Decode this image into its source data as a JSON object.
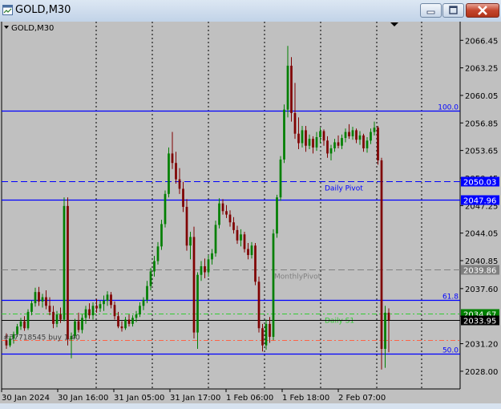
{
  "window": {
    "title": "GOLD,M30",
    "icon": "chart-window-icon",
    "controls": [
      "minimize-icon",
      "maximize-icon",
      "close-icon"
    ]
  },
  "chart_header": {
    "label": "GOLD,M30",
    "icon": "triangle-down-icon"
  },
  "colors": {
    "background": "#c0c0c0",
    "candle_up": "#007f00",
    "candle_down": "#7f0000",
    "level_line": "#0000ff",
    "monthly_pivot": "#808080",
    "daily_s1": "#32cd32",
    "order_line": "#ff6347",
    "price_tag_bg": "#0000ff",
    "current_price_bg": "#008000"
  },
  "chart_data": {
    "type": "candlestick",
    "symbol": "GOLD",
    "timeframe": "M30",
    "ylim": [
      2026.5,
      2067.5
    ],
    "y_ticks": [
      "2066.45",
      "2063.25",
      "2060.05",
      "2056.85",
      "2053.65",
      "2050.45",
      "2047.25",
      "2044.05",
      "2040.85",
      "2037.60",
      "2034.40",
      "2031.20",
      "2028.00"
    ],
    "x_ticks": [
      "30 Jan 2024",
      "30 Jan 16:00",
      "31 Jan 05:00",
      "31 Jan 17:00",
      "1 Feb 06:00",
      "1 Feb 18:00",
      "2 Feb 07:00"
    ],
    "levels": [
      {
        "name": "100.0",
        "price": 2058.3,
        "color": "#0000ff",
        "style": "solid",
        "label_side": "right"
      },
      {
        "name": "Daily Pivot",
        "price": 2050.03,
        "color": "#0000ff",
        "style": "dashed",
        "label_side": "center",
        "tag": "2050.03"
      },
      {
        "name": "",
        "price": 2047.96,
        "color": "#0000ff",
        "style": "solid",
        "label_side": "none",
        "tag": "2047.96"
      },
      {
        "name": "MonthlyPivot",
        "price": 2039.86,
        "color": "#808080",
        "style": "dashed",
        "label_side": "center",
        "tag": "2039.86"
      },
      {
        "name": "61.8",
        "price": 2036.3,
        "color": "#0000ff",
        "style": "solid",
        "label_side": "right"
      },
      {
        "name": "Daily S1",
        "price": 2034.67,
        "color": "#32cd32",
        "style": "dashdot",
        "label_side": "center",
        "tag": "2034.67"
      },
      {
        "name": "",
        "price": 2033.95,
        "color": "#000000",
        "style": "solid",
        "label_side": "none",
        "tag": "2033.95"
      },
      {
        "name": "",
        "price": 2031.6,
        "color": "#ff6347",
        "style": "dashdot",
        "label_side": "none"
      },
      {
        "name": "50.0",
        "price": 2030.0,
        "color": "#0000ff",
        "style": "solid",
        "label_side": "right"
      }
    ],
    "order_label": "#37718545 buy 1.40",
    "period_separators": [
      "30 Jan 16:00",
      "31 Jan 05:00",
      "31 Jan 17:00",
      "1 Feb 06:00",
      "1 Feb 18:00",
      "2 Feb 07:00",
      "2 Feb 20:00"
    ],
    "candles": [
      [
        2031.6,
        2032.4,
        2030.6,
        2031.0
      ],
      [
        2031.0,
        2032.1,
        2030.8,
        2031.8
      ],
      [
        2031.8,
        2032.6,
        2031.2,
        2032.3
      ],
      [
        2032.3,
        2033.5,
        2032.0,
        2033.2
      ],
      [
        2033.2,
        2034.2,
        2032.8,
        2033.8
      ],
      [
        2033.8,
        2034.4,
        2032.7,
        2033.0
      ],
      [
        2033.0,
        2035.2,
        2032.8,
        2034.9
      ],
      [
        2034.9,
        2036.2,
        2034.5,
        2035.9
      ],
      [
        2035.9,
        2037.7,
        2035.5,
        2037.2
      ],
      [
        2037.2,
        2037.8,
        2035.6,
        2036.1
      ],
      [
        2036.1,
        2037.0,
        2035.4,
        2036.6
      ],
      [
        2036.6,
        2037.4,
        2035.2,
        2035.6
      ],
      [
        2035.6,
        2036.6,
        2034.5,
        2034.9
      ],
      [
        2034.9,
        2035.6,
        2033.0,
        2033.5
      ],
      [
        2033.5,
        2035.0,
        2033.1,
        2034.6
      ],
      [
        2034.6,
        2035.4,
        2033.6,
        2034.0
      ],
      [
        2034.0,
        2048.2,
        2033.8,
        2047.2
      ],
      [
        2047.2,
        2048.2,
        2031.0,
        2031.7
      ],
      [
        2031.7,
        2032.5,
        2029.5,
        2032.1
      ],
      [
        2032.1,
        2034.1,
        2031.8,
        2033.8
      ],
      [
        2033.8,
        2034.8,
        2032.5,
        2032.8
      ],
      [
        2032.8,
        2034.6,
        2032.4,
        2034.2
      ],
      [
        2034.2,
        2035.6,
        2033.5,
        2035.2
      ],
      [
        2035.2,
        2035.9,
        2034.1,
        2034.5
      ],
      [
        2034.5,
        2036.0,
        2034.0,
        2035.6
      ],
      [
        2035.6,
        2036.4,
        2034.8,
        2035.3
      ],
      [
        2035.3,
        2036.2,
        2034.9,
        2035.8
      ],
      [
        2035.8,
        2036.8,
        2035.0,
        2036.2
      ],
      [
        2036.2,
        2037.3,
        2035.6,
        2036.9
      ],
      [
        2036.9,
        2037.2,
        2035.3,
        2035.7
      ],
      [
        2035.7,
        2036.1,
        2034.0,
        2034.4
      ],
      [
        2034.4,
        2034.9,
        2033.0,
        2033.2
      ],
      [
        2033.2,
        2033.8,
        2032.6,
        2033.0
      ],
      [
        2033.0,
        2034.3,
        2032.8,
        2034.0
      ],
      [
        2034.0,
        2034.6,
        2033.2,
        2033.5
      ],
      [
        2033.5,
        2034.5,
        2033.2,
        2034.2
      ],
      [
        2034.2,
        2035.0,
        2033.7,
        2034.6
      ],
      [
        2034.6,
        2036.0,
        2034.3,
        2035.6
      ],
      [
        2035.6,
        2036.6,
        2035.1,
        2036.3
      ],
      [
        2036.3,
        2038.5,
        2035.9,
        2037.9
      ],
      [
        2037.9,
        2040.0,
        2037.4,
        2039.6
      ],
      [
        2039.6,
        2041.4,
        2039.0,
        2040.8
      ],
      [
        2040.8,
        2043.0,
        2040.4,
        2042.5
      ],
      [
        2042.5,
        2045.6,
        2042.1,
        2045.1
      ],
      [
        2045.1,
        2049.0,
        2044.7,
        2048.6
      ],
      [
        2048.6,
        2054.0,
        2048.2,
        2053.3
      ],
      [
        2053.3,
        2055.8,
        2051.5,
        2052.2
      ],
      [
        2052.2,
        2053.5,
        2049.8,
        2050.3
      ],
      [
        2050.3,
        2051.6,
        2048.6,
        2049.2
      ],
      [
        2049.2,
        2050.0,
        2046.5,
        2047.1
      ],
      [
        2047.1,
        2048.0,
        2042.0,
        2042.6
      ],
      [
        2042.6,
        2044.2,
        2041.0,
        2043.6
      ],
      [
        2043.6,
        2044.8,
        2031.8,
        2032.5
      ],
      [
        2032.5,
        2039.5,
        2030.6,
        2039.2
      ],
      [
        2039.2,
        2040.8,
        2038.5,
        2040.2
      ],
      [
        2040.2,
        2041.1,
        2038.8,
        2039.5
      ],
      [
        2039.5,
        2041.5,
        2039.0,
        2041.0
      ],
      [
        2041.0,
        2042.2,
        2040.4,
        2041.7
      ],
      [
        2041.7,
        2045.5,
        2041.3,
        2045.0
      ],
      [
        2045.0,
        2048.1,
        2044.6,
        2047.5
      ],
      [
        2047.5,
        2048.0,
        2046.2,
        2046.6
      ],
      [
        2046.6,
        2047.3,
        2045.8,
        2046.2
      ],
      [
        2046.2,
        2046.7,
        2044.8,
        2045.3
      ],
      [
        2045.3,
        2045.9,
        2044.0,
        2044.4
      ],
      [
        2044.4,
        2044.9,
        2042.8,
        2043.2
      ],
      [
        2043.2,
        2044.5,
        2042.5,
        2043.9
      ],
      [
        2043.9,
        2044.2,
        2041.8,
        2042.2
      ],
      [
        2042.2,
        2042.9,
        2041.0,
        2041.5
      ],
      [
        2041.5,
        2043.0,
        2041.1,
        2042.6
      ],
      [
        2042.6,
        2042.9,
        2038.0,
        2038.4
      ],
      [
        2038.4,
        2039.0,
        2032.5,
        2033.0
      ],
      [
        2033.0,
        2033.5,
        2030.3,
        2031.0
      ],
      [
        2031.0,
        2034.0,
        2030.5,
        2033.5
      ],
      [
        2033.5,
        2034.3,
        2031.3,
        2032.0
      ],
      [
        2032.0,
        2044.5,
        2031.6,
        2044.0
      ],
      [
        2044.0,
        2048.5,
        2043.5,
        2048.2
      ],
      [
        2048.2,
        2053.0,
        2047.8,
        2052.6
      ],
      [
        2052.6,
        2059.0,
        2052.2,
        2058.4
      ],
      [
        2058.4,
        2065.8,
        2057.5,
        2063.5
      ],
      [
        2063.5,
        2064.5,
        2057.0,
        2058.0
      ],
      [
        2058.0,
        2061.5,
        2055.0,
        2055.6
      ],
      [
        2055.6,
        2057.5,
        2053.8,
        2054.5
      ],
      [
        2054.5,
        2056.5,
        2054.0,
        2056.0
      ],
      [
        2056.0,
        2056.5,
        2053.5,
        2054.2
      ],
      [
        2054.2,
        2055.5,
        2053.8,
        2055.0
      ],
      [
        2055.0,
        2055.3,
        2053.3,
        2054.0
      ],
      [
        2054.0,
        2055.8,
        2053.6,
        2055.2
      ],
      [
        2055.2,
        2056.3,
        2054.5,
        2055.9
      ],
      [
        2055.9,
        2056.1,
        2054.2,
        2054.8
      ],
      [
        2054.8,
        2055.3,
        2052.8,
        2053.3
      ],
      [
        2053.3,
        2054.3,
        2052.5,
        2053.9
      ],
      [
        2053.9,
        2055.0,
        2053.5,
        2054.6
      ],
      [
        2054.6,
        2055.4,
        2053.9,
        2054.2
      ],
      [
        2054.2,
        2055.5,
        2053.8,
        2055.1
      ],
      [
        2055.1,
        2056.2,
        2054.6,
        2055.8
      ],
      [
        2055.8,
        2056.7,
        2055.0,
        2055.3
      ],
      [
        2055.3,
        2056.4,
        2054.9,
        2056.0
      ],
      [
        2056.0,
        2056.2,
        2054.5,
        2054.9
      ],
      [
        2054.9,
        2055.9,
        2054.3,
        2055.4
      ],
      [
        2055.4,
        2055.6,
        2053.5,
        2053.9
      ],
      [
        2053.9,
        2055.2,
        2053.4,
        2054.8
      ],
      [
        2054.8,
        2056.2,
        2054.4,
        2055.8
      ],
      [
        2055.8,
        2057.0,
        2055.4,
        2056.3
      ],
      [
        2056.3,
        2056.5,
        2052.0,
        2052.5
      ],
      [
        2052.5,
        2052.8,
        2028.2,
        2030.6
      ],
      [
        2030.6,
        2035.6,
        2028.4,
        2034.8
      ],
      [
        2034.8,
        2035.3,
        2030.2,
        2033.95
      ]
    ]
  }
}
